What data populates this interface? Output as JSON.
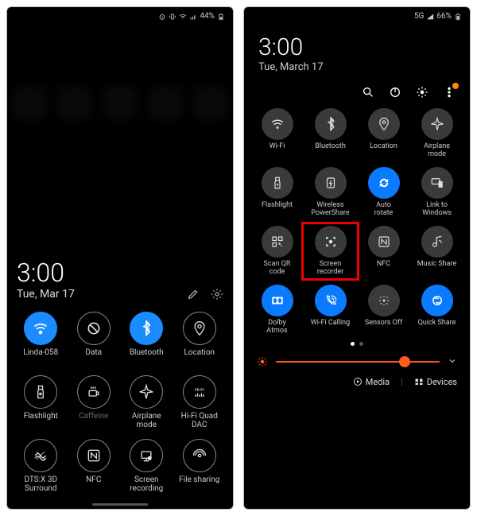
{
  "left": {
    "status": {
      "battery": "44%"
    },
    "clock": {
      "time": "3:00",
      "date": "Tue, Mar 17"
    },
    "tiles": [
      {
        "id": "wifi",
        "label": "Linda-058",
        "on": true
      },
      {
        "id": "data",
        "label": "Data",
        "on": false
      },
      {
        "id": "bluetooth",
        "label": "Bluetooth",
        "on": true
      },
      {
        "id": "location",
        "label": "Location",
        "on": false
      },
      {
        "id": "flashlight",
        "label": "Flashlight",
        "on": false
      },
      {
        "id": "caffeine",
        "label": "Caffeine",
        "on": false,
        "dim": true
      },
      {
        "id": "airplane",
        "label": "Airplane\nmode",
        "on": false
      },
      {
        "id": "hifi",
        "label": "Hi-Fi Quad\nDAC",
        "on": false
      },
      {
        "id": "dtsx",
        "label": "DTS:X 3D\nSurround",
        "on": false
      },
      {
        "id": "nfc",
        "label": "NFC",
        "on": false
      },
      {
        "id": "screenrec",
        "label": "Screen\nrecording",
        "on": false
      },
      {
        "id": "fileshare",
        "label": "File sharing",
        "on": false
      }
    ]
  },
  "right": {
    "status": {
      "network": "5G",
      "battery": "66%"
    },
    "clock": {
      "time": "3:00",
      "date": "Tue, March 17"
    },
    "tiles": [
      {
        "id": "wifi",
        "label": "Wi-Fi",
        "on": false
      },
      {
        "id": "bluetooth",
        "label": "Bluetooth",
        "on": false
      },
      {
        "id": "location",
        "label": "Location",
        "on": false
      },
      {
        "id": "airplane",
        "label": "Airplane\nmode",
        "on": false
      },
      {
        "id": "flashlight",
        "label": "Flashlight",
        "on": false
      },
      {
        "id": "powershare",
        "label": "Wireless\nPowerShare",
        "on": false
      },
      {
        "id": "autorotate",
        "label": "Auto\nrotate",
        "on": true
      },
      {
        "id": "linkwin",
        "label": "Link to\nWindows",
        "on": false
      },
      {
        "id": "qrcode",
        "label": "Scan QR\ncode",
        "on": false
      },
      {
        "id": "screenrec",
        "label": "Screen\nrecorder",
        "on": false,
        "highlight": true
      },
      {
        "id": "nfc",
        "label": "NFC",
        "on": false
      },
      {
        "id": "musicshare",
        "label": "Music Share",
        "on": false
      },
      {
        "id": "dolby",
        "label": "Dolby\nAtmos",
        "on": true
      },
      {
        "id": "wificall",
        "label": "Wi-Fi Calling",
        "on": true
      },
      {
        "id": "sensorsoff",
        "label": "Sensors Off",
        "on": false
      },
      {
        "id": "quickshare",
        "label": "Quick Share",
        "on": true
      }
    ],
    "brightness": 82,
    "bottom": {
      "media": "Media",
      "devices": "Devices"
    }
  }
}
